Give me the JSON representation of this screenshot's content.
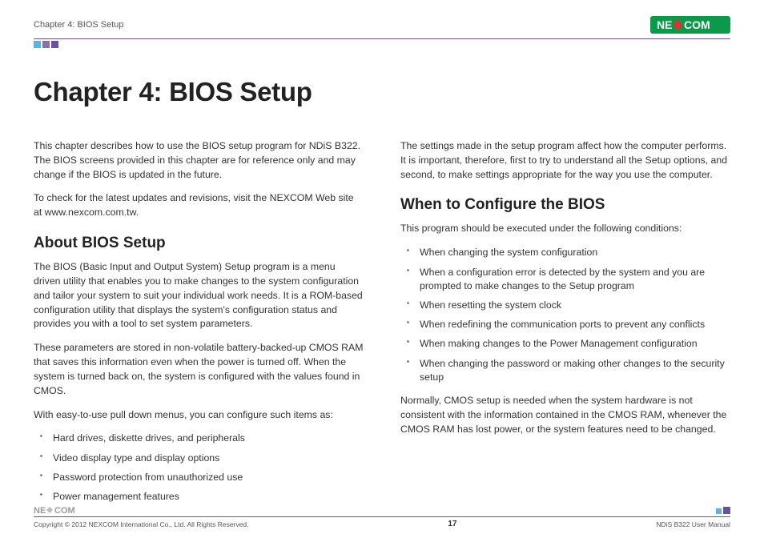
{
  "header": {
    "chapter": "Chapter 4: BIOS Setup",
    "logo_text": "NEXCOM"
  },
  "title": "Chapter 4: BIOS Setup",
  "left": {
    "intro1": "This chapter describes how to use the BIOS setup program for NDiS B322. The BIOS screens provided in this chapter are for reference only and may change if the BIOS is updated in the future.",
    "intro2": "To check for the latest updates and revisions, visit the NEXCOM Web site at www.nexcom.com.tw.",
    "h_about": "About BIOS Setup",
    "about1": "The BIOS (Basic Input and Output System) Setup program is a menu driven utility that enables you to make changes to the system configuration and tailor your system to suit your individual work needs. It is a ROM-based configuration utility that displays the system's configuration status and provides you with a tool to set system parameters.",
    "about2": "These parameters are stored in non-volatile battery-backed-up CMOS RAM that saves this information even when the power is turned off. When the system is turned back on, the system is configured with the values found in CMOS.",
    "about3": "With easy-to-use pull down menus, you can configure such items as:",
    "items": [
      "Hard drives, diskette drives, and peripherals",
      "Video display type and display options",
      "Password protection from unauthorized use",
      "Power management features"
    ]
  },
  "right": {
    "intro": "The settings made in the setup program affect how the computer performs. It is important, therefore, first to try to understand all the Setup options, and second, to make settings appropriate for the way you use the computer.",
    "h_when": "When to Configure the BIOS",
    "when_intro": "This program should be executed under the following conditions:",
    "conditions": [
      "When changing the system configuration",
      "When a configuration error is detected by the system and you are prompted to make changes to the Setup program",
      "When resetting the system clock",
      "When redefining the communication ports to prevent any conflicts",
      "When making changes to the Power Management configuration",
      "When changing the password or making other changes to the security setup"
    ],
    "closing": "Normally, CMOS setup is needed when the system hardware is not consistent with the information contained in the CMOS RAM, whenever the CMOS RAM has lost power, or the system features need to be changed."
  },
  "footer": {
    "copyright": "Copyright © 2012 NEXCOM International Co., Ltd. All Rights Reserved.",
    "page": "17",
    "doc": "NDiS B322 User Manual",
    "logo_text": "NEXCOM"
  }
}
